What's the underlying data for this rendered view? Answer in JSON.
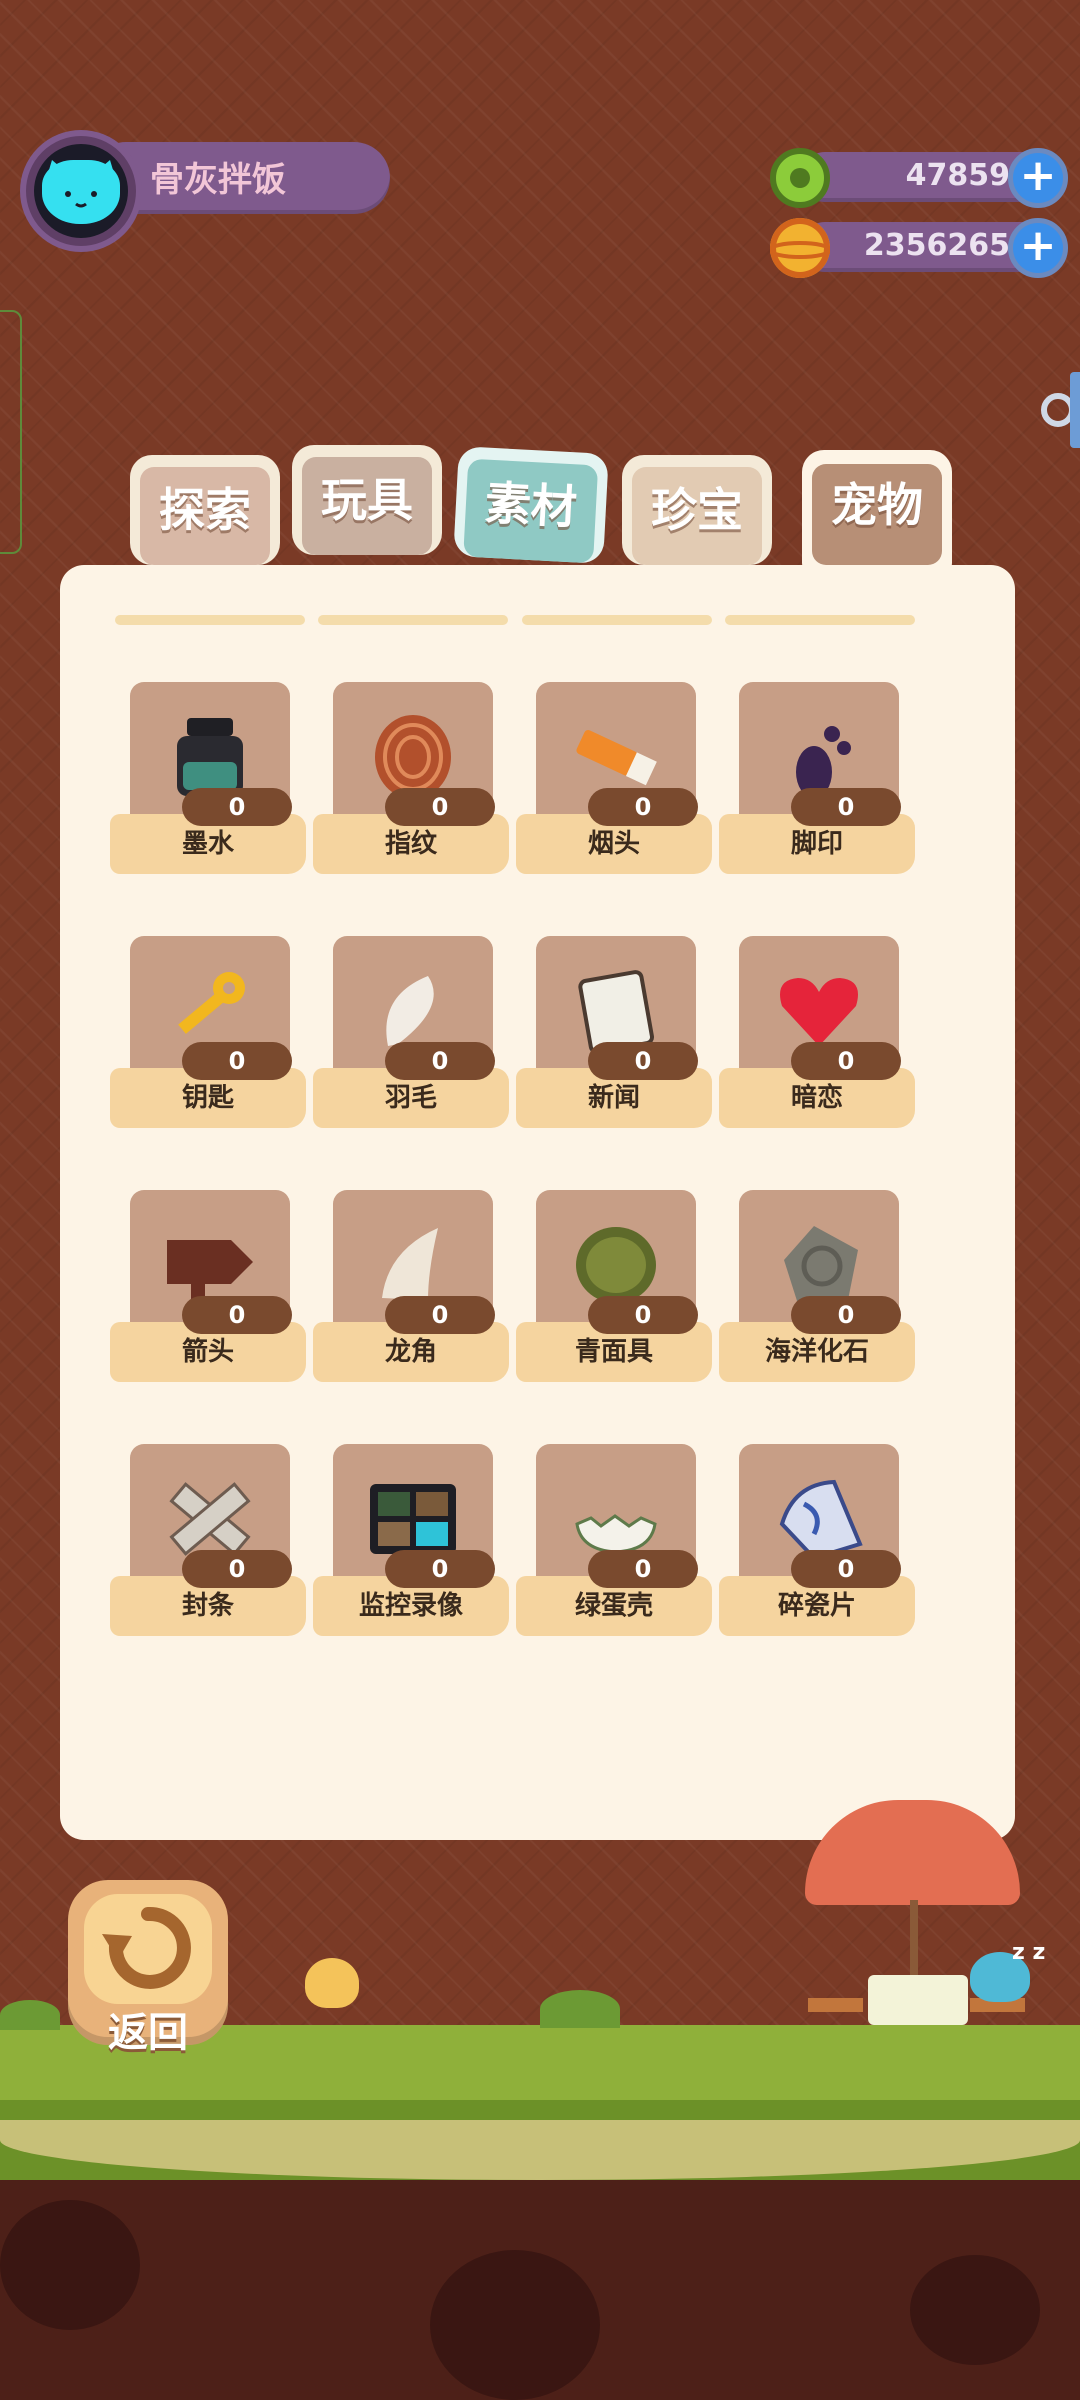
{
  "profile": {
    "name": "骨灰拌饭",
    "avatar_icon": "cat-avatar-icon"
  },
  "currencies": [
    {
      "icon": "green-donut-coin-icon",
      "value": "47859",
      "color": "#8ccc3a"
    },
    {
      "icon": "gold-planet-coin-icon",
      "value": "2356265",
      "color": "#f2b230"
    }
  ],
  "tabs": [
    {
      "label": "探索",
      "color": "#d8b8a6",
      "active": false
    },
    {
      "label": "玩具",
      "color": "#c9b0a0",
      "active": false
    },
    {
      "label": "素材",
      "color": "#8fc9c4",
      "active": false
    },
    {
      "label": "珍宝",
      "color": "#e2cbb3",
      "active": false
    },
    {
      "label": "宠物",
      "color": "#b78f76",
      "active": true
    }
  ],
  "items": [
    {
      "name": "墨水",
      "count": "0",
      "icon": "ink-bottle-icon"
    },
    {
      "name": "指纹",
      "count": "0",
      "icon": "fingerprint-icon"
    },
    {
      "name": "烟头",
      "count": "0",
      "icon": "cigarette-butt-icon"
    },
    {
      "name": "脚印",
      "count": "0",
      "icon": "footprint-icon"
    },
    {
      "name": "钥匙",
      "count": "0",
      "icon": "key-icon"
    },
    {
      "name": "羽毛",
      "count": "0",
      "icon": "feather-icon"
    },
    {
      "name": "新闻",
      "count": "0",
      "icon": "newspaper-icon"
    },
    {
      "name": "暗恋",
      "count": "0",
      "icon": "heart-icon"
    },
    {
      "name": "箭头",
      "count": "0",
      "icon": "arrow-sign-icon"
    },
    {
      "name": "龙角",
      "count": "0",
      "icon": "dragon-horn-icon"
    },
    {
      "name": "青面具",
      "count": "0",
      "icon": "green-mask-icon"
    },
    {
      "name": "海洋化石",
      "count": "0",
      "icon": "ammonite-fossil-icon"
    },
    {
      "name": "封条",
      "count": "0",
      "icon": "seal-tape-icon"
    },
    {
      "name": "监控录像",
      "count": "0",
      "icon": "surveillance-monitor-icon"
    },
    {
      "name": "绿蛋壳",
      "count": "0",
      "icon": "green-eggshell-icon"
    },
    {
      "name": "碎瓷片",
      "count": "0",
      "icon": "porcelain-shard-icon"
    }
  ],
  "bottom": {
    "return_label": "返回",
    "zzz": "z z"
  }
}
